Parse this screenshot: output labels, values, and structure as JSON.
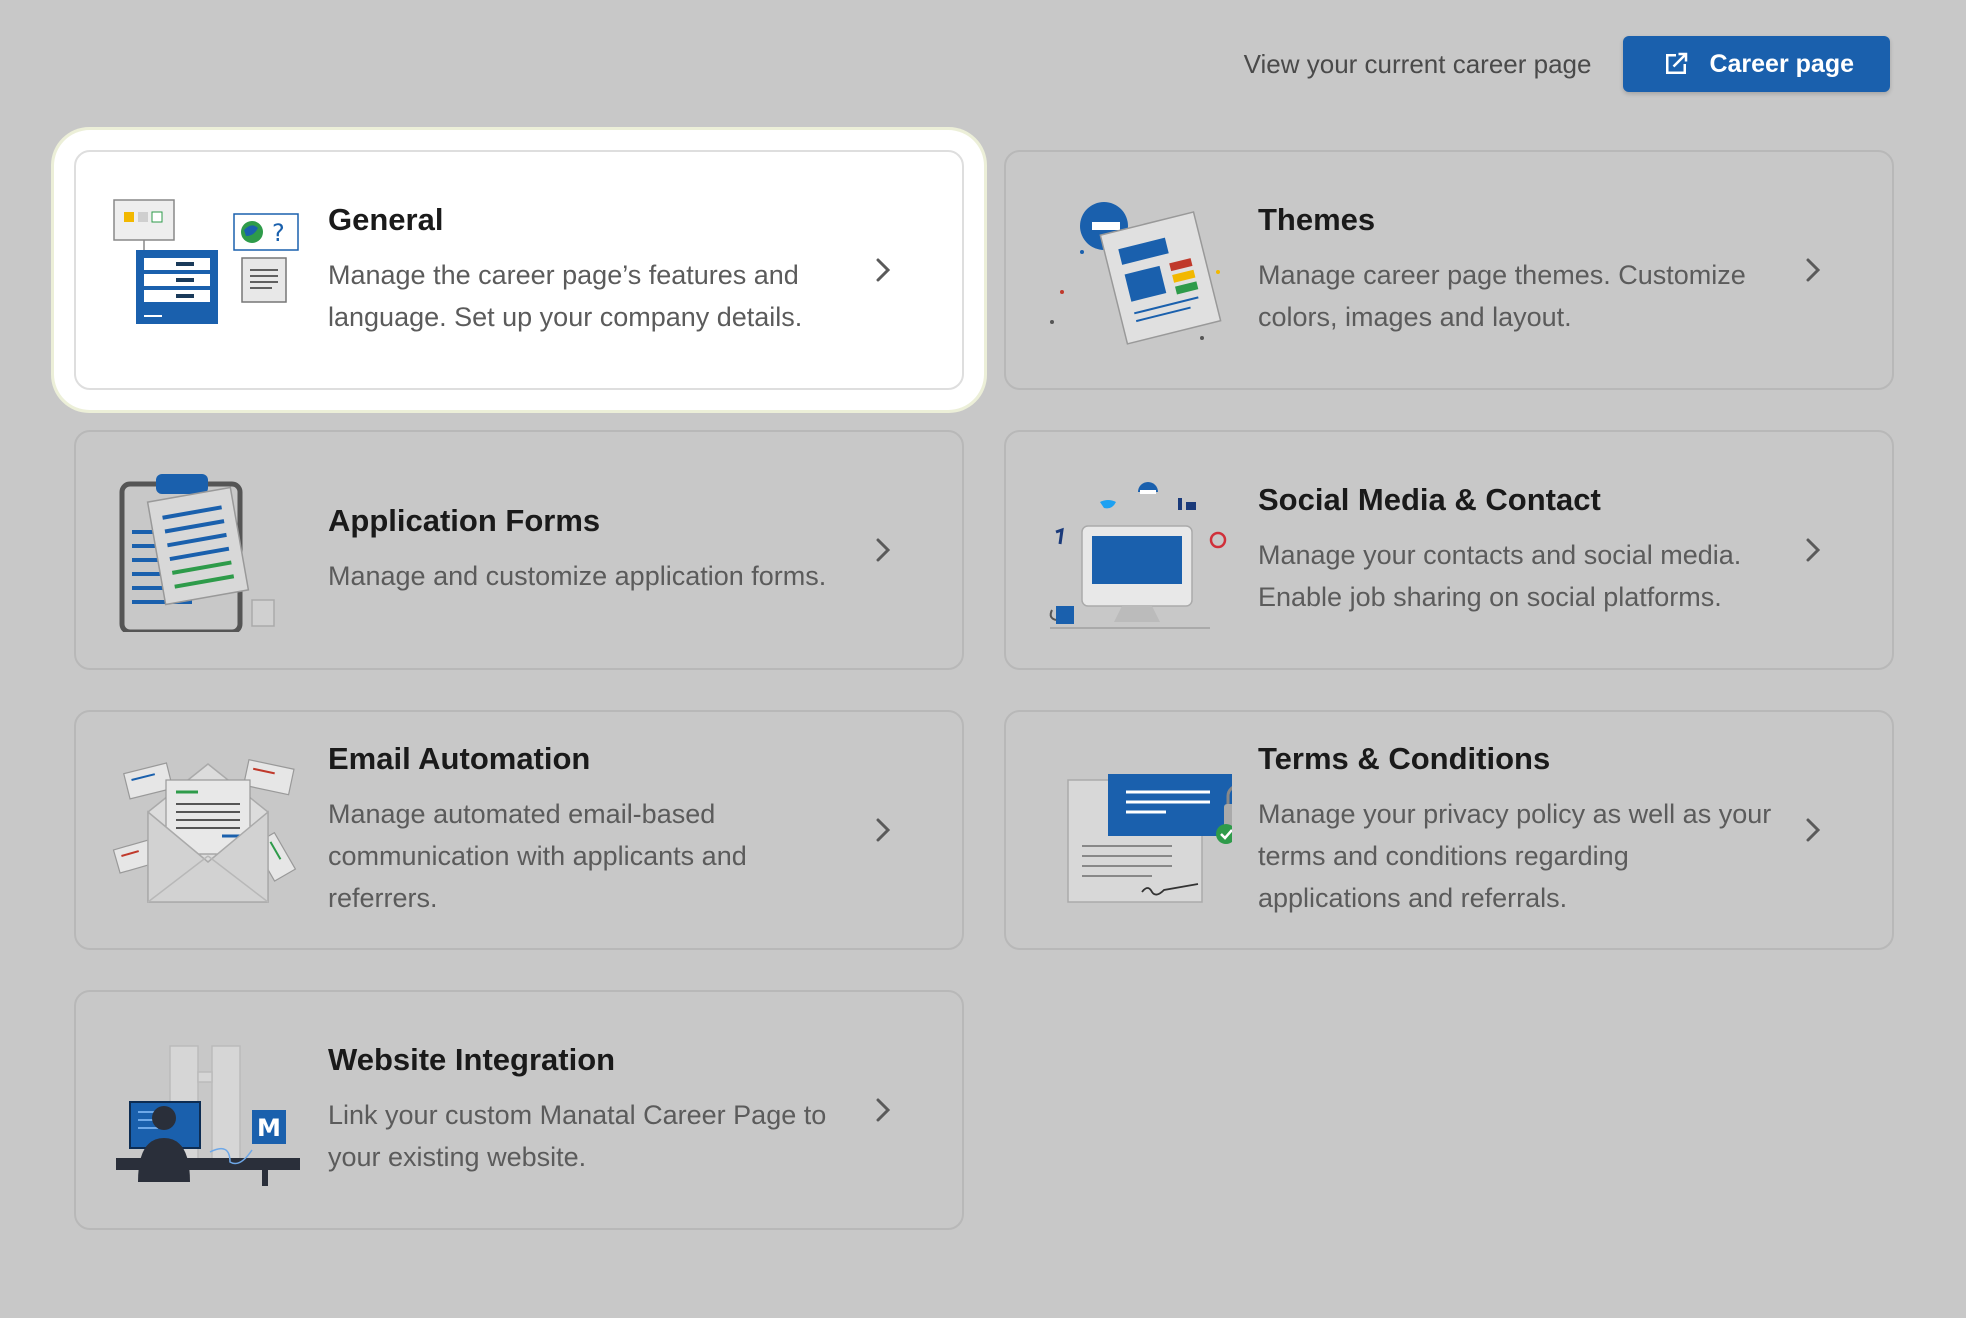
{
  "topbar": {
    "text": "View your current career page",
    "button_label": "Career page"
  },
  "cards": [
    {
      "title": "General",
      "desc": "Manage the career page’s features and language. Set up your company details."
    },
    {
      "title": "Themes",
      "desc": "Manage career page themes. Customize colors, images and layout."
    },
    {
      "title": "Application Forms",
      "desc": "Manage and customize application forms."
    },
    {
      "title": "Social Media & Contact",
      "desc": "Manage your contacts and social media. Enable job sharing on social platforms."
    },
    {
      "title": "Email Automation",
      "desc": "Manage automated email-based communication with applicants and referrers."
    },
    {
      "title": "Terms & Conditions",
      "desc": "Manage your privacy policy as well as your terms and conditions regarding applications and referrals."
    },
    {
      "title": "Website Integration",
      "desc": "Link your custom Manatal Career Page to your existing website."
    }
  ],
  "illustration_text": {
    "integration_logo": "M",
    "general_help": "?"
  },
  "colors": {
    "accent": "#1a60ad",
    "background": "#c8c8c8",
    "active_card": "#ffffff"
  }
}
